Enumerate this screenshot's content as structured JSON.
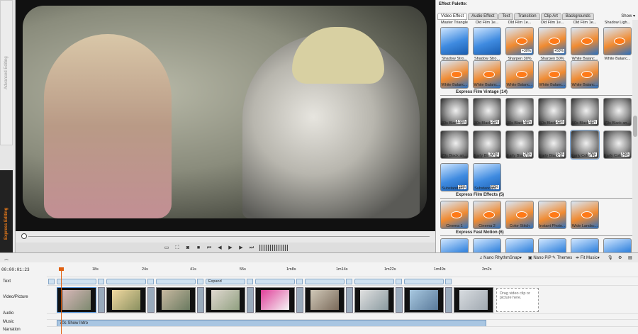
{
  "side_tabs": {
    "advanced": "Advanced Editing",
    "express": "Express Editing"
  },
  "palette": {
    "title": "Effect Palette:",
    "tabs": [
      "Video Effect",
      "Audio Effect",
      "Text",
      "Transition",
      "Clip Art",
      "Backgrounds"
    ],
    "show_label": "Show",
    "top_labels": [
      "Master Triangle",
      "Old Film 1e...",
      "Old Film 1e...",
      "Old Film 1e...",
      "Old Film 1e...",
      "Shadow Ligh...",
      "Shadow Ligh..."
    ],
    "row1": [
      {
        "label": "Shadow Stro...",
        "pct": ""
      },
      {
        "label": "Shadow Stro...",
        "pct": ""
      },
      {
        "label": "Sharpen 30%",
        "pct": "+30%"
      },
      {
        "label": "Sharpen 50%",
        "pct": "+50%"
      },
      {
        "label": "White Balanc...",
        "pct": ""
      },
      {
        "label": "White Balanc...",
        "pct": ""
      }
    ],
    "row2": [
      {
        "label": "White Balanc..."
      },
      {
        "label": "White Balanc..."
      },
      {
        "label": "White Balanc..."
      },
      {
        "label": "White Balanc..."
      },
      {
        "label": "White Balanc..."
      }
    ],
    "vintage_title": "Express Film Vintage (14)",
    "vintage": [
      {
        "label": "30s Black an...",
        "pct": "100%"
      },
      {
        "label": "30s Black an...",
        "pct": "25%"
      },
      {
        "label": "30s Black an...",
        "pct": "50%"
      },
      {
        "label": "50s Black an...",
        "pct": "25%"
      },
      {
        "label": "50s Black an...",
        "pct": "50%"
      },
      {
        "label": "70s Black an...",
        "pct": ""
      },
      {
        "label": "70s Black an...",
        "pct": ""
      },
      {
        "label": "Early Black a...",
        "pct": "100%"
      },
      {
        "label": "Early Black a...",
        "pct": "25%"
      },
      {
        "label": "Early Black a...",
        "pct": "50%"
      },
      {
        "label": "Early Color Fi...",
        "pct": "25%"
      },
      {
        "label": "Early Color Fi...",
        "pct": "50%"
      },
      {
        "label": "Substandard...",
        "pct": "25%"
      },
      {
        "label": "Substandard...",
        "pct": "50%"
      }
    ],
    "effects_title": "Express Film Effects (5)",
    "effects": [
      "Cinema 1",
      "Cinema 2",
      "Color Stitch",
      "Instant Photo...",
      "Wide Landsc..."
    ],
    "fast_title": "Express Fast Motion (6)"
  },
  "toolbar": {
    "rhythm": "Nano RhythmSnap",
    "pip": "Nano PiP",
    "themes": "Themes",
    "fit_music": "Fit Music"
  },
  "timeline": {
    "timecode": "00:00:01:23",
    "ruler": [
      "18s",
      "24s",
      "41s",
      "55s",
      "1m8s",
      "1m14s",
      "1m22s",
      "1m49s",
      "2m2s"
    ],
    "tracks": [
      "Text",
      "Video/Picture",
      "Audio",
      "Music",
      "Narration"
    ],
    "text_expand": "Expand",
    "drop_hint": "Drag video clip or picture here.",
    "music_clip": "70s Show Intro"
  }
}
